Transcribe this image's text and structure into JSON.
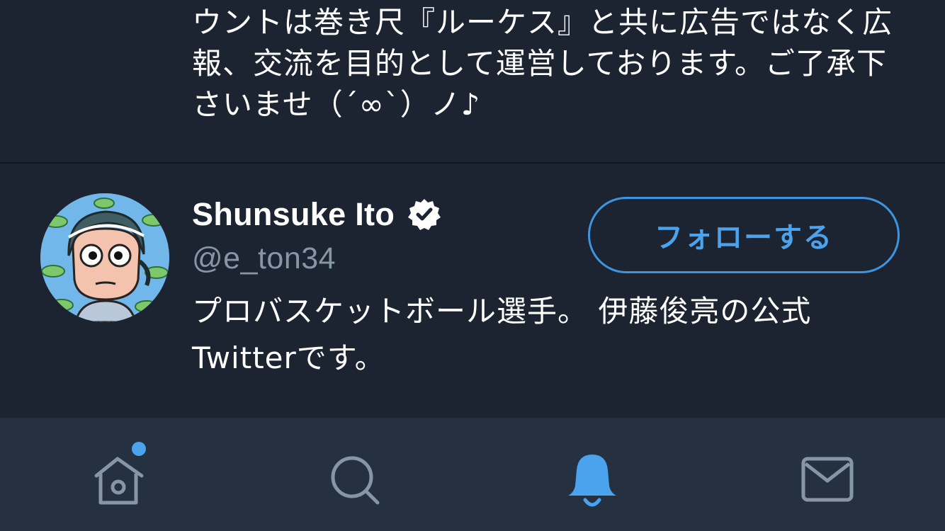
{
  "previous_user": {
    "bio": "ウントは巻き尺『ルーケス』と共に広告ではなく広報、交流を目的として運営しております。ご了承下さいませ（´∞`）ノ♪"
  },
  "user": {
    "display_name": "Shunsuke Ito",
    "handle": "@e_ton34",
    "verified": true,
    "follow_button_label": "フォローする",
    "bio": "プロバスケットボール選手。 伊藤俊亮の公式Twitterです。"
  },
  "tab_bar": {
    "tabs": [
      {
        "icon": "home-icon",
        "active": false,
        "has_notification_dot": true
      },
      {
        "icon": "search-icon",
        "active": false,
        "has_notification_dot": false
      },
      {
        "icon": "bell-icon",
        "active": true,
        "has_notification_dot": false
      },
      {
        "icon": "mail-icon",
        "active": false,
        "has_notification_dot": false
      }
    ]
  },
  "colors": {
    "background": "#1b2430",
    "tab_bar_background": "#253141",
    "accent": "#4aa3ec",
    "secondary_text": "#8696a6",
    "inactive_icon": "#8696a6"
  }
}
